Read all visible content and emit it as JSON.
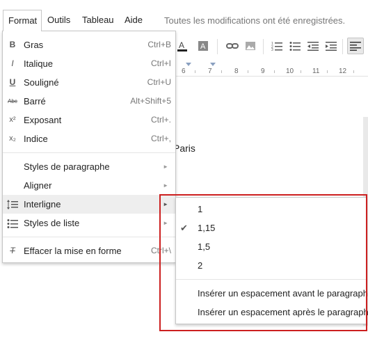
{
  "menubar": {
    "items": [
      {
        "label": "Format"
      },
      {
        "label": "Outils"
      },
      {
        "label": "Tableau"
      },
      {
        "label": "Aide"
      }
    ],
    "save_status": "Toutes les modifications ont été enregistrées."
  },
  "toolbar": {
    "icons": [
      "text-color-icon",
      "highlight-color-icon",
      "link-icon",
      "image-icon",
      "numbered-list-icon",
      "bulleted-list-icon",
      "decrease-indent-icon",
      "increase-indent-icon",
      "align-left-icon"
    ]
  },
  "ruler": {
    "labels": [
      "6",
      "7",
      "8",
      "9",
      "10",
      "11",
      "12"
    ]
  },
  "document": {
    "visible_text": "Paris"
  },
  "format_menu": {
    "items": [
      {
        "icon": "B",
        "label": "Gras",
        "shortcut": "Ctrl+B"
      },
      {
        "icon": "I",
        "label": "Italique",
        "shortcut": "Ctrl+I"
      },
      {
        "icon": "U",
        "label": "Souligné",
        "shortcut": "Ctrl+U"
      },
      {
        "icon": "Abc",
        "label": "Barré",
        "shortcut": "Alt+Shift+5"
      },
      {
        "icon": "x²",
        "label": "Exposant",
        "shortcut": "Ctrl+."
      },
      {
        "icon": "x₂",
        "label": "Indice",
        "shortcut": "Ctrl+,"
      },
      {
        "label": "Styles de paragraphe"
      },
      {
        "label": "Aligner"
      },
      {
        "label": "Interligne"
      },
      {
        "label": "Styles de liste"
      },
      {
        "label": "Effacer la mise en forme",
        "shortcut": "Ctrl+\\"
      }
    ]
  },
  "line_spacing_submenu": {
    "items": [
      {
        "label": "1",
        "checked": false
      },
      {
        "label": "1,15",
        "checked": true
      },
      {
        "label": "1,5",
        "checked": false
      },
      {
        "label": "2",
        "checked": false
      },
      {
        "label": "Insérer un espacement avant le paragraphe"
      },
      {
        "label": "Insérer un espacement après le paragraphe"
      }
    ],
    "check_glyph": "✔"
  },
  "colors": {
    "highlight_border": "#cc1f1f",
    "hover_row": "#eeeeee"
  }
}
